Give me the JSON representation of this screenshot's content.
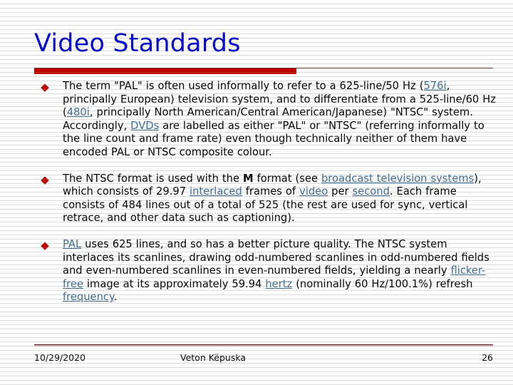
{
  "slide": {
    "title": "Video Standards",
    "accent_red": "#C00000",
    "title_blue": "#0000CD",
    "link_blue": "#3d6d94",
    "bullet_glyph": "◆",
    "bullets": [
      {
        "id": "bullet-pal-ntsc-informal",
        "segments": [
          {
            "text": "The term \"PAL\" is often used informally to refer to a 625-line/50 Hz (",
            "kind": "plain"
          },
          {
            "text": "576i",
            "kind": "link"
          },
          {
            "text": ", principally European) television system, and to differentiate from a 525-line/60 Hz (",
            "kind": "plain"
          },
          {
            "text": "480i",
            "kind": "link"
          },
          {
            "text": ", principally North American/Central American/Japanese) \"NTSC\" system. Accordingly, ",
            "kind": "plain"
          },
          {
            "text": "DVDs",
            "kind": "link"
          },
          {
            "text": " are labelled as either \"PAL\" or \"NTSC\" (referring informally to the line count and frame rate) even though technically neither of them have encoded PAL or NTSC composite colour.",
            "kind": "plain"
          }
        ]
      },
      {
        "id": "bullet-ntsc-m-format",
        "segments": [
          {
            "text": "The NTSC format is used with the ",
            "kind": "plain"
          },
          {
            "text": "M",
            "kind": "bold"
          },
          {
            "text": " format (see ",
            "kind": "plain"
          },
          {
            "text": "broadcast television systems",
            "kind": "link"
          },
          {
            "text": "), which consists of 29.97 ",
            "kind": "plain"
          },
          {
            "text": "interlaced",
            "kind": "link"
          },
          {
            "text": " frames of ",
            "kind": "plain"
          },
          {
            "text": "video",
            "kind": "link"
          },
          {
            "text": " per ",
            "kind": "plain"
          },
          {
            "text": "second",
            "kind": "link"
          },
          {
            "text": ". Each frame consists of 484 lines out of a total of 525 (the rest are used for sync, vertical retrace, and other data such as captioning).",
            "kind": "plain"
          }
        ]
      },
      {
        "id": "bullet-pal-625-lines",
        "segments": [
          {
            "text": "PAL",
            "kind": "link"
          },
          {
            "text": " uses 625 lines, and so has a better picture quality. The NTSC system interlaces its scanlines, drawing odd-numbered scanlines in odd-numbered fields and even-numbered scanlines in even-numbered fields, yielding a nearly ",
            "kind": "plain"
          },
          {
            "text": "flicker-free",
            "kind": "link"
          },
          {
            "text": " image at its approximately 59.94 ",
            "kind": "plain"
          },
          {
            "text": "hertz",
            "kind": "link"
          },
          {
            "text": " (nominally 60 Hz/100.1%) refresh ",
            "kind": "plain"
          },
          {
            "text": "frequency",
            "kind": "link"
          },
          {
            "text": ".",
            "kind": "plain"
          }
        ]
      }
    ]
  },
  "footer": {
    "date": "10/29/2020",
    "author": "Veton Këpuska",
    "page_number": "26"
  }
}
